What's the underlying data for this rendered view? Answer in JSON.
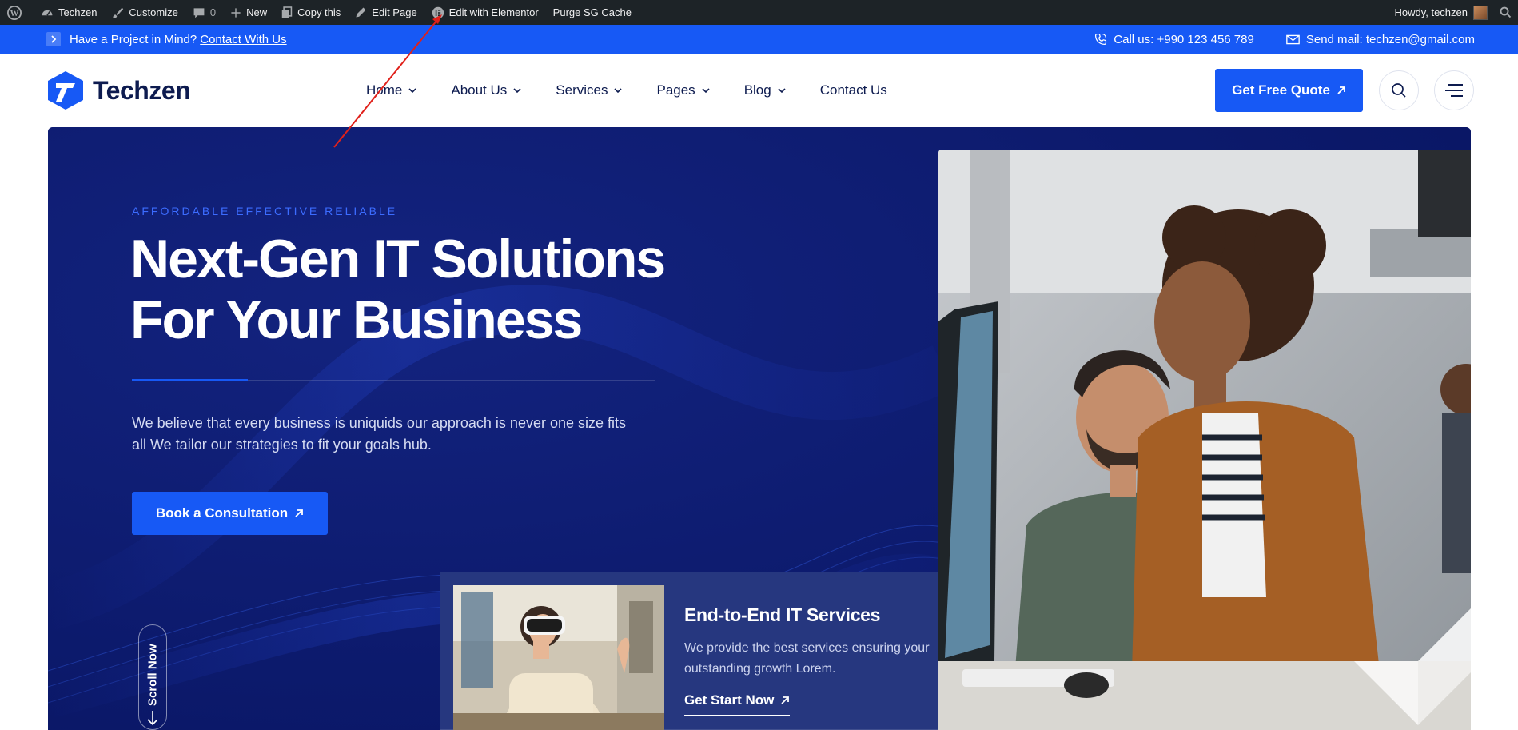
{
  "adminbar": {
    "site_name": "Techzen",
    "customize": "Customize",
    "comments_count": "0",
    "new_label": "New",
    "copy_label": "Copy this",
    "edit_page": "Edit Page",
    "edit_elementor": "Edit with Elementor",
    "purge_cache": "Purge SG Cache",
    "howdy": "Howdy, techzen"
  },
  "topbar": {
    "project_text": "Have a Project in Mind?",
    "contact_link": "Contact With Us",
    "phone": "Call us: +990 123 456 789",
    "email": "Send mail: techzen@gmail.com"
  },
  "header": {
    "logo_text": "Techzen",
    "nav": [
      {
        "label": "Home",
        "dropdown": true
      },
      {
        "label": "About Us",
        "dropdown": true
      },
      {
        "label": "Services",
        "dropdown": true
      },
      {
        "label": "Pages",
        "dropdown": true
      },
      {
        "label": "Blog",
        "dropdown": true
      },
      {
        "label": "Contact Us",
        "dropdown": false
      }
    ],
    "cta_label": "Get Free Quote"
  },
  "hero": {
    "eyebrow": "AFFORDABLE EFFECTIVE RELIABLE",
    "title_line1": "Next-Gen IT Solutions",
    "title_line2": "For Your Business",
    "description": "We believe that every business is uniquids our approach is never one size fits all We tailor our strategies to fit your goals hub.",
    "button_label": "Book a Consultation",
    "scroll_label": "Scroll Now"
  },
  "service_card": {
    "title": "End-to-End IT Services",
    "description": "We provide the best services ensuring your outstanding growth Lorem.",
    "link_label": "Get Start Now"
  },
  "colors": {
    "accent": "#1759f5",
    "admin_bar": "#1d2327",
    "hero_bg": "#0b1a6e",
    "heading": "#0d1b4f",
    "annotation": "#e0201a"
  },
  "icons": [
    "wordpress-icon",
    "dashboard-icon",
    "brush-icon",
    "comment-icon",
    "plus-icon",
    "copy-icon",
    "pencil-icon",
    "elementor-icon",
    "search-icon",
    "chevron-right-icon",
    "phone-icon",
    "mail-icon",
    "chevron-down-icon",
    "arrow-up-right-icon",
    "menu-icon",
    "arrow-down-icon"
  ]
}
